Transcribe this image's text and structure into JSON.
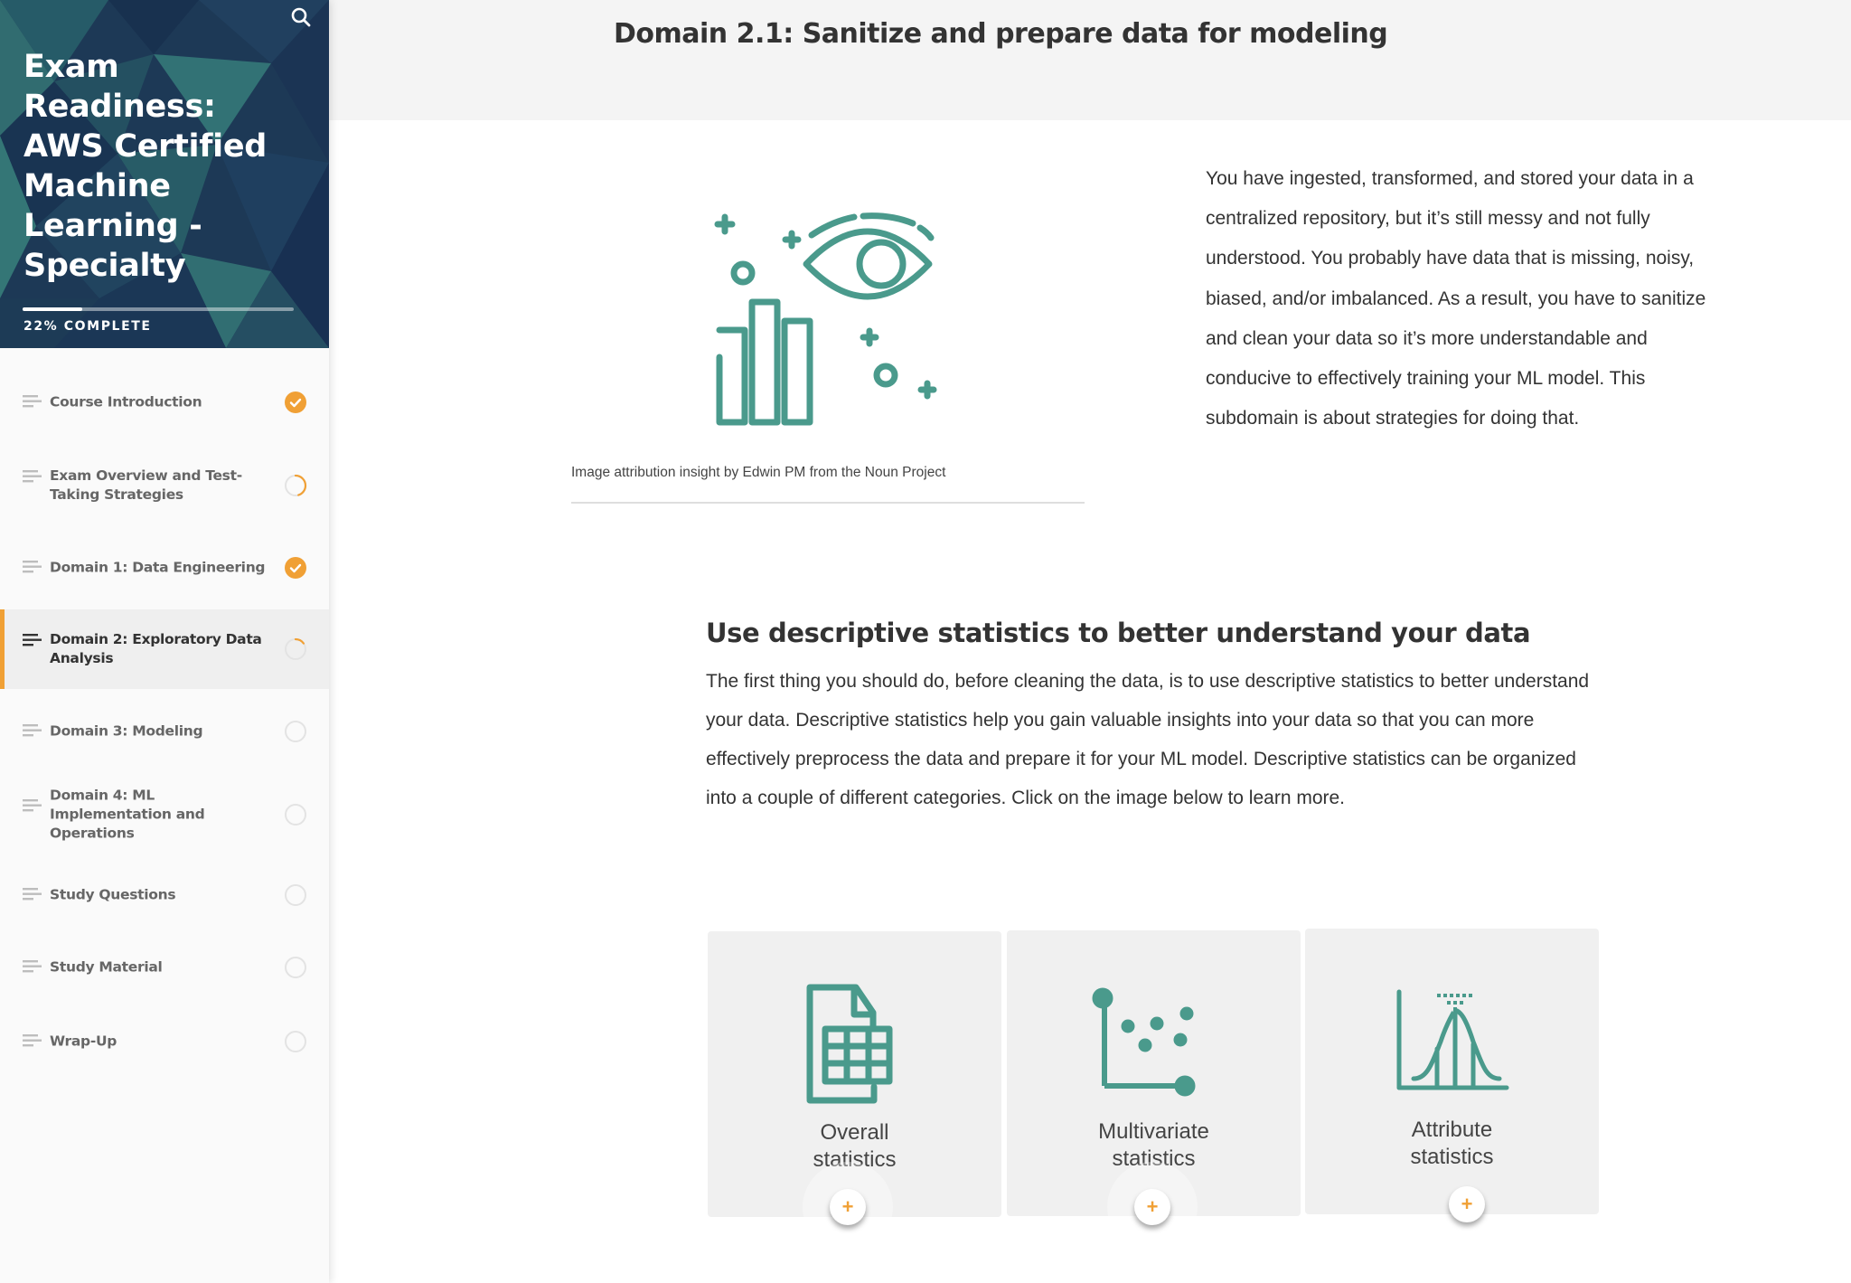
{
  "sidebar": {
    "course_title": "Exam Readiness: AWS Certified Machine Learning - Specialty",
    "progress_percent": 22,
    "progress_label": "22% COMPLETE",
    "search_icon": "search-icon",
    "items": [
      {
        "label": "Course Introduction",
        "status": "complete",
        "active": false
      },
      {
        "label": "Exam Overview and Test-Taking Strategies",
        "status": "in-progress",
        "progress": 0.45,
        "active": false
      },
      {
        "label": "Domain 1: Data Engineering",
        "status": "complete",
        "active": false
      },
      {
        "label": "Domain 2: Exploratory Data Analysis",
        "status": "in-progress",
        "progress": 0.15,
        "active": true
      },
      {
        "label": "Domain 3: Modeling",
        "status": "not-started",
        "active": false
      },
      {
        "label": "Domain 4: ML Implementation and Operations",
        "status": "not-started",
        "active": false
      },
      {
        "label": "Study Questions",
        "status": "not-started",
        "active": false
      },
      {
        "label": "Study Material",
        "status": "not-started",
        "active": false
      },
      {
        "label": "Wrap-Up",
        "status": "not-started",
        "active": false
      }
    ]
  },
  "header": {
    "title": "Domain 2.1: Sanitize and prepare data for modeling"
  },
  "intro": {
    "image_icon": "insight-eye-chart-icon",
    "caption": "Image attribution insight by Edwin PM from the Noun Project",
    "text": "You have ingested, transformed, and stored your data in a centralized repository, but it’s still messy and not fully understood. You probably have data that is missing, noisy, biased, and/or imbalanced. As a result, you have to sanitize and clean your data so it’s more understandable and conducive to effectively training your ML model. This subdomain is about strategies for doing that."
  },
  "section": {
    "heading": "Use descriptive statistics to better understand your data",
    "body": "The first thing you should do, before cleaning the data, is to use descriptive statistics to better understand your data. Descriptive statistics help you gain valuable insights into your data so that you can more effectively preprocess the data and prepare it for your ML model. Descriptive statistics can be organized into a couple of different categories. Click on the image below to learn more."
  },
  "cards": [
    {
      "line1": "Overall",
      "line2": "statistics",
      "icon": "spreadsheet-icon",
      "button": "+"
    },
    {
      "line1": "Multivariate",
      "line2": "statistics",
      "icon": "scatter-plot-icon",
      "button": "+"
    },
    {
      "line1": "Attribute",
      "line2": "statistics",
      "icon": "bell-curve-icon",
      "button": "+"
    }
  ],
  "colors": {
    "accent_orange": "#f0a035",
    "icon_teal": "#4a9a8c",
    "sidebar_header": "#1f3b5a"
  }
}
